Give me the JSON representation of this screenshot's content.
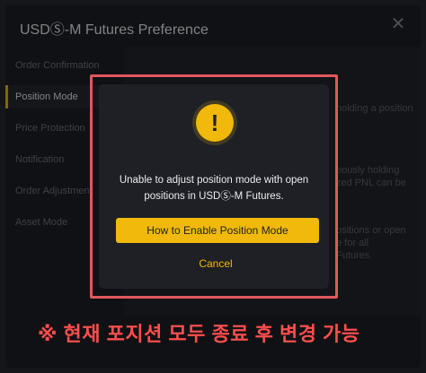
{
  "header": {
    "title": "USDⓈ-M Futures Preference",
    "close_glyph": "✕"
  },
  "sidebar": {
    "items": [
      {
        "label": "Order Confirmation",
        "active": false
      },
      {
        "label": "Position Mode",
        "active": true
      },
      {
        "label": "Price Protection",
        "active": false
      },
      {
        "label": "Notification",
        "active": false
      },
      {
        "label": "Order Adjustment",
        "active": false
      },
      {
        "label": "Asset Mode",
        "active": false
      }
    ]
  },
  "content": {
    "fragments": [
      "holding a position",
      "eously holding",
      "zed PNL can be",
      "ositions or open",
      "e for all",
      "Futures."
    ]
  },
  "modal": {
    "icon": "warning-icon",
    "icon_glyph": "!",
    "message": "Unable to adjust position mode with open positions in USDⓈ-M Futures.",
    "primary_label": "How to Enable Position Mode",
    "cancel_label": "Cancel"
  },
  "caption": "※ 현재 포지션 모두 종료 후 변경 가능",
  "colors": {
    "accent": "#f0b90b",
    "highlight_outline": "#e0585a",
    "caption": "#ff4e4e"
  }
}
